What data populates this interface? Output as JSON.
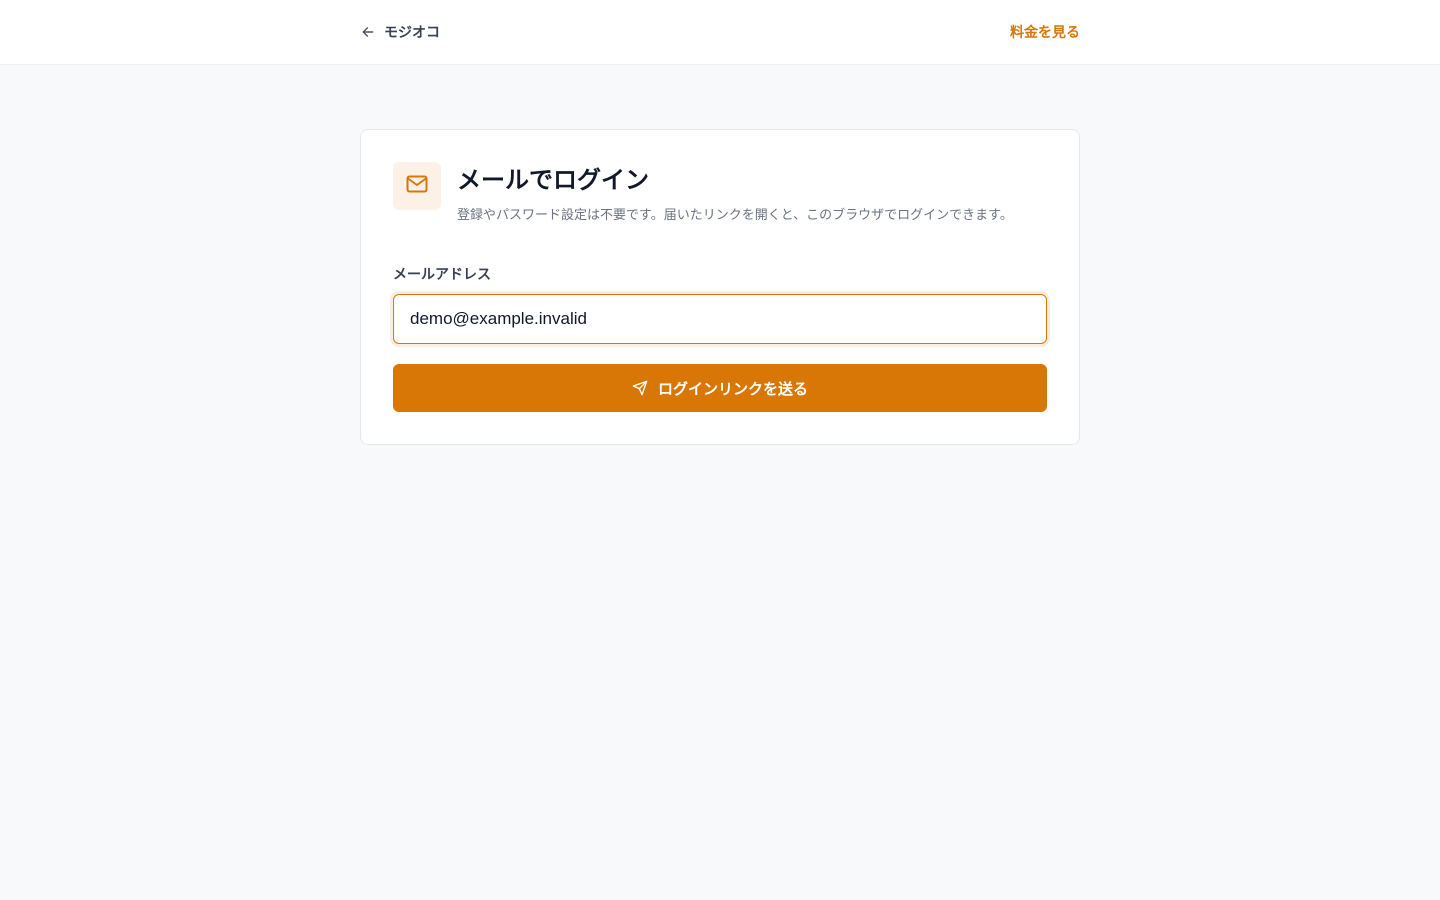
{
  "header": {
    "back_label": "モジオコ",
    "back_icon": "arrow-left-icon",
    "pricing_label": "料金を見る"
  },
  "login_card": {
    "icon": "mail-icon",
    "title": "メールでログイン",
    "subtitle": "登録やパスワード設定は不要です。届いたリンクを開くと、このブラウザでログインできます。",
    "email_label": "メールアドレス",
    "email_value": "demo@example.invalid",
    "submit_label": "ログインリンクを送る",
    "submit_icon": "send-icon"
  },
  "colors": {
    "accent": "#d97706",
    "badge_bg": "#fdf1e7",
    "page_bg": "#f8f9fb",
    "title_text": "#111827",
    "muted_text": "#6b7280"
  }
}
